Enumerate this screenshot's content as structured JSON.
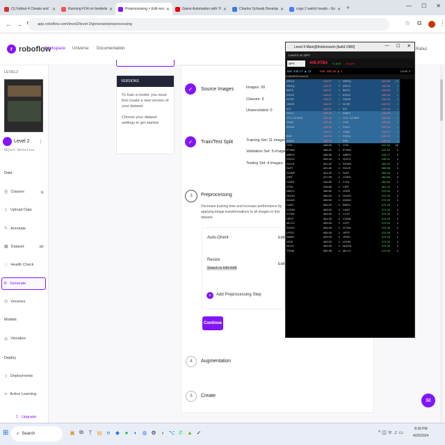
{
  "tabs": [
    {
      "label": "(1) Fallout 4 Cheats and Trainer",
      "color": "#c33"
    },
    {
      "label": "Running FO4 on borderless wi",
      "color": "#e55"
    },
    {
      "label": "Preprocessing > Edit resize",
      "color": "#8315f9"
    },
    {
      "label": "Game Automation with YOLO",
      "color": "#e00"
    },
    {
      "label": "Charles Schwab Developer Por",
      "color": "#3b7bd4"
    },
    {
      "label": "csgo 2 switch heads - Google",
      "color": "#4a80f5"
    }
  ],
  "url": "app.roboflow.com/level2/level-2/generate/preprocessing",
  "nav": {
    "logo": "roboflow",
    "workspace": "Workspace",
    "universe": "Universe",
    "documentation": "Documentation",
    "user": "Rahul"
  },
  "sidebar": {
    "project_section": "LEVEL2",
    "project_name": "Level 2",
    "project_type": "Object Detection",
    "data_label": "Data",
    "models_label": "Models",
    "deploy_label": "Deploy",
    "data_items": [
      {
        "label": "Classes",
        "icon": "list-icon",
        "badge": "5"
      },
      {
        "label": "Upload Data",
        "icon": "upload-icon",
        "badge": ""
      },
      {
        "label": "Annotate",
        "icon": "annotate-icon",
        "badge": ""
      },
      {
        "label": "Dataset",
        "icon": "dataset-icon",
        "badge": "20"
      },
      {
        "label": "Health Check",
        "icon": "health-icon",
        "badge": ""
      },
      {
        "label": "Generate",
        "icon": "generate-icon",
        "badge": ""
      },
      {
        "label": "Versions",
        "icon": "versions-icon",
        "badge": ""
      }
    ],
    "model_items": [
      {
        "label": "Visualize",
        "icon": "visualize-icon"
      }
    ],
    "deploy_items": [
      {
        "label": "Deployments",
        "icon": "deployments-icon"
      },
      {
        "label": "Active Learning",
        "icon": "active-learning-icon"
      }
    ],
    "upgrade": "Upgrade"
  },
  "versions": {
    "header": "VERSIONS",
    "text1": "To train a model, you must first create a new version of your dataset.",
    "text2": "Choose your dataset settings to get started."
  },
  "steps": {
    "source": {
      "title": "Source Images",
      "images": "Images: 20",
      "classes": "Classes: 5",
      "unannotated": "Unannotated: 0"
    },
    "split": {
      "title": "Train/Test Split",
      "training": "Training Set: 11 images",
      "validation": "Validation Set: 5 images",
      "testing": "Testing Set: 4 images"
    },
    "preprocessing": {
      "number": "3",
      "title": "Preprocessing",
      "desc": "Decrease training time and increase performance by applying image transformations to all images in this dataset.",
      "auto_orient": "Auto-Orient",
      "resize": "Resize",
      "resize_value": "Stretch to 640×640",
      "edit": "Edit",
      "add_step": "Add Preprocessing Step",
      "continue": "Continue"
    },
    "augmentation": {
      "number": "4",
      "title": "Augmentation"
    },
    "create": {
      "number": "5",
      "title": "Create"
    }
  },
  "terminal": {
    "title": "Level II Main@thinkorswim [build 1980]",
    "subtitle": "Level II on SPY",
    "symbol": "SPY",
    "price": "448.97B4",
    "change1": "+1.81%",
    "change2": "+8.80%",
    "bid_info": "Bid: 448.17 ▲ 11",
    "ask_info": "Ask: 448.18 ▲ 1",
    "level_label": "Level II",
    "headers": [
      "Ex",
      "Bid",
      "BS",
      "Ex",
      "Ask",
      "AS"
    ],
    "rows": [
      [
        "ARCA",
        "448.97",
        "2",
        "NSDQ",
        "442.88",
        "10"
      ],
      [
        "NSDQ",
        "448.97",
        "2",
        "ARCA",
        "448.98",
        "1"
      ],
      [
        "BATS",
        "448.97",
        "2",
        "BATS",
        "448.98",
        "1"
      ],
      [
        "EDGX",
        "448.97",
        "1",
        "EDGX",
        "448.98",
        "1"
      ],
      [
        "NYSE",
        "448.97",
        "1",
        "CBOE",
        "448.98",
        "4"
      ],
      [
        "CBOE",
        "448.97",
        "1",
        "NYSE",
        "448.98",
        "1"
      ],
      [
        "IEX",
        "448.97",
        "1",
        "IEX",
        "448.98",
        "1"
      ],
      [
        "PHLX",
        "448.96",
        "1",
        "AMEX",
        "448.98",
        "1"
      ],
      [
        "OTC OTHER",
        "448.96",
        "1",
        "OTC OTHER",
        "448.98",
        "1"
      ],
      [
        "CINN",
        "448.96",
        "1",
        "CHX",
        "448.98",
        "1"
      ],
      [
        "EDGA",
        "448.96",
        "1",
        "PHLX",
        "448.98",
        "1"
      ],
      [
        "",
        "448.95",
        "1",
        "CINN",
        "448.99",
        "1"
      ],
      [
        "BSE",
        "448.95",
        "1",
        "EDGA",
        "448.99",
        "1"
      ],
      [
        "AMEX",
        "448.95",
        "1",
        "BSE",
        "448.99",
        "1"
      ],
      [
        "CHX",
        "448.60",
        "1",
        "CHX",
        "441.40",
        "40"
      ],
      [
        "ETMM",
        "439.41",
        "1",
        "ETMM",
        "441.62",
        "1"
      ],
      [
        "WBPX",
        "435.99",
        "2",
        "WBPX",
        "445.77",
        "2"
      ],
      [
        "GSCO",
        "433.15",
        "1",
        "GSCO",
        "446.41",
        "1"
      ],
      [
        "SGUS",
        "421.40",
        "1",
        "SGWD",
        "456.32",
        "1"
      ],
      [
        "SUFI",
        "421.40",
        "1",
        "SGUS",
        "456.58",
        "1"
      ],
      [
        "SGWD",
        "421.20",
        "1",
        "SUFI",
        "456.58",
        "1"
      ],
      [
        "VIRT",
        "417.99",
        "1",
        "CDRG",
        "460.56",
        "2"
      ],
      [
        "CDRG",
        "416.69",
        "2",
        "CTDL",
        "460.56",
        "1"
      ],
      [
        "CTDL",
        "416.69",
        "1",
        "VIRT",
        "461.00",
        "1"
      ],
      [
        "NMCC",
        "406.50",
        "1",
        "LEER",
        "474.30",
        "2"
      ],
      [
        "OHOS",
        "404.00",
        "2",
        "OHOS",
        "474.30",
        "1"
      ],
      [
        "ADAM",
        "404.00",
        "1",
        "ADAM",
        "474.30",
        "1"
      ],
      [
        "CANT",
        "404.00",
        "1",
        "BMOC",
        "474.30",
        "1"
      ],
      [
        "CONN",
        "404.00",
        "1",
        "CANT",
        "474.30",
        "1"
      ],
      [
        "GTSM",
        "404.00",
        "1",
        "CLST",
        "474.30",
        "1"
      ],
      [
        "HRTF",
        "404.00",
        "1",
        "CONN",
        "474.30",
        "1"
      ],
      [
        "MLCO",
        "404.00",
        "1",
        "CSTI",
        "474.30",
        "1"
      ],
      [
        "SOHO",
        "404.00",
        "1",
        "GTSM",
        "474.30",
        "1"
      ],
      [
        "LRSG",
        "404.00",
        "1",
        "HRTF",
        "474.30",
        "1"
      ],
      [
        "NABR",
        "404.00",
        "1",
        "JPMS",
        "474.30",
        "1"
      ],
      [
        "NSSI",
        "404.00",
        "1",
        "LEHM",
        "474.30",
        "1"
      ],
      [
        "NCVV",
        "404.00",
        "1",
        "MAXM",
        "474.30",
        "1"
      ],
      [
        "TSSM",
        "352.98",
        "1",
        "MLCO",
        "474.30",
        "1"
      ]
    ]
  },
  "taskbar": {
    "search": "Search",
    "time": "8:39 PM",
    "date": "4/25/2024"
  }
}
